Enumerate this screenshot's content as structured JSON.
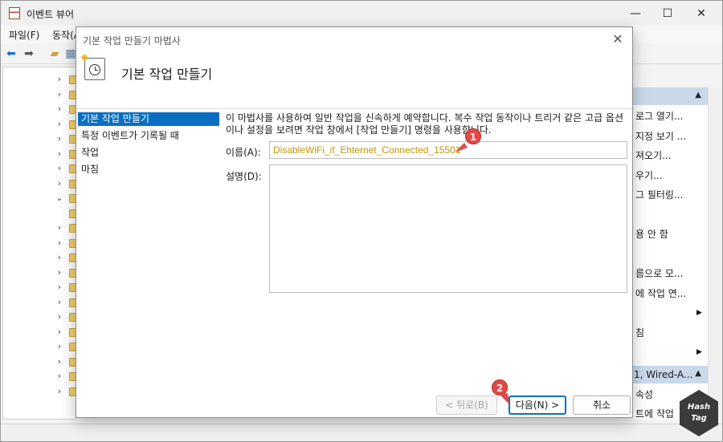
{
  "app": {
    "title": "이벤트 뷰어",
    "window_controls": {
      "minimize": "—",
      "maximize": "☐",
      "close": "✕"
    }
  },
  "menu": [
    {
      "label": "파일(F)"
    },
    {
      "label": "동작(A)"
    }
  ],
  "toolbar_icons": [
    "back-arrow-icon",
    "forward-arrow-icon",
    "folder-up-icon",
    "view-icon"
  ],
  "tree": {
    "rows": [
      {
        "chev": "›"
      },
      {
        "chev": "›"
      },
      {
        "chev": "›"
      },
      {
        "chev": "›"
      },
      {
        "chev": "›"
      },
      {
        "chev": "›"
      },
      {
        "chev": "›"
      },
      {
        "chev": "›"
      },
      {
        "chev": "⌄"
      },
      {
        "chev": ""
      },
      {
        "chev": "›"
      },
      {
        "chev": "›"
      },
      {
        "chev": "›"
      },
      {
        "chev": "›"
      },
      {
        "chev": "›"
      },
      {
        "chev": "›"
      },
      {
        "chev": "›"
      },
      {
        "chev": "›"
      },
      {
        "chev": "›"
      },
      {
        "chev": "›"
      },
      {
        "chev": "›"
      },
      {
        "chev": "›"
      }
    ]
  },
  "actions": {
    "section1_header": "",
    "items": [
      "로그 열기...",
      "지정 보기 ...",
      "져오기...",
      "우기...",
      "그 필터링...",
      "",
      "용 안 함",
      "",
      "름으로 모...",
      "에 작업 연...",
      "",
      "침",
      ""
    ],
    "section2_header": "1, Wired-A...",
    "section2_items": [
      "속성",
      "트에 작업"
    ]
  },
  "wizard": {
    "title": "기본 작업 만들기 마법사",
    "close": "✕",
    "heading": "기본 작업 만들기",
    "steps": [
      {
        "label": "기본 작업 만들기",
        "active": true
      },
      {
        "label": "특정 이벤트가 기록될 때",
        "active": false
      },
      {
        "label": "작업",
        "active": false
      },
      {
        "label": "마침",
        "active": false
      }
    ],
    "description": "이 마법사를 사용하여 일반 작업을 신속하게 예약합니다. 복수 작업 동작이나 트리거 같은 고급 옵션이나 설정을 보려면 작업 창에서 [작업 만들기] 명령을 사용합니다.",
    "name_label": "이름(A):",
    "name_value": "DisableWiFi_if_Ehternet_Connected_15501",
    "desc_label": "설명(D):",
    "desc_value": "",
    "buttons": {
      "back": "< 뒤로(B)",
      "next": "다음(N) >",
      "cancel": "취소"
    }
  },
  "markers": [
    "1",
    "2"
  ],
  "badge": {
    "line1": "Hash",
    "line2": "Tag"
  },
  "colors": {
    "selection": "#0a6fc2",
    "marker": "#e44848",
    "name_text": "#c39700"
  }
}
